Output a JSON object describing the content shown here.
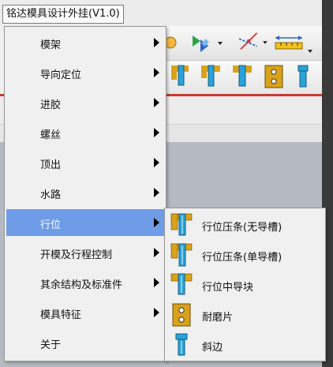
{
  "menubar": {
    "title": "铭达模具设计外挂(V1.0)"
  },
  "menu": {
    "items": [
      {
        "label": "模架",
        "has_submenu": true
      },
      {
        "label": "导向定位",
        "has_submenu": true
      },
      {
        "label": "进胶",
        "has_submenu": true
      },
      {
        "label": "螺丝",
        "has_submenu": true
      },
      {
        "label": "顶出",
        "has_submenu": true
      },
      {
        "label": "水路",
        "has_submenu": true
      },
      {
        "label": "行位",
        "has_submenu": true,
        "active": true
      },
      {
        "label": "开模及行程控制",
        "has_submenu": true
      },
      {
        "label": "其余结构及标准件",
        "has_submenu": true
      },
      {
        "label": "模具特征",
        "has_submenu": true
      },
      {
        "label": "关于",
        "has_submenu": false
      }
    ]
  },
  "submenu": {
    "items": [
      {
        "label": "行位压条(无导槽)",
        "icon": "slider-strip-icon"
      },
      {
        "label": "行位压条(单导槽)",
        "icon": "slider-strip-single-icon"
      },
      {
        "label": "行位中导块",
        "icon": "slider-guide-block-icon"
      },
      {
        "label": "耐磨片",
        "icon": "wear-plate-icon"
      },
      {
        "label": "斜边",
        "icon": "bevel-pin-icon"
      }
    ]
  },
  "colors": {
    "highlight": "#6f9ce7",
    "icon_blue": "#2aa3d8",
    "icon_gold": "#d9a21b",
    "accent_red": "#c83a32"
  }
}
